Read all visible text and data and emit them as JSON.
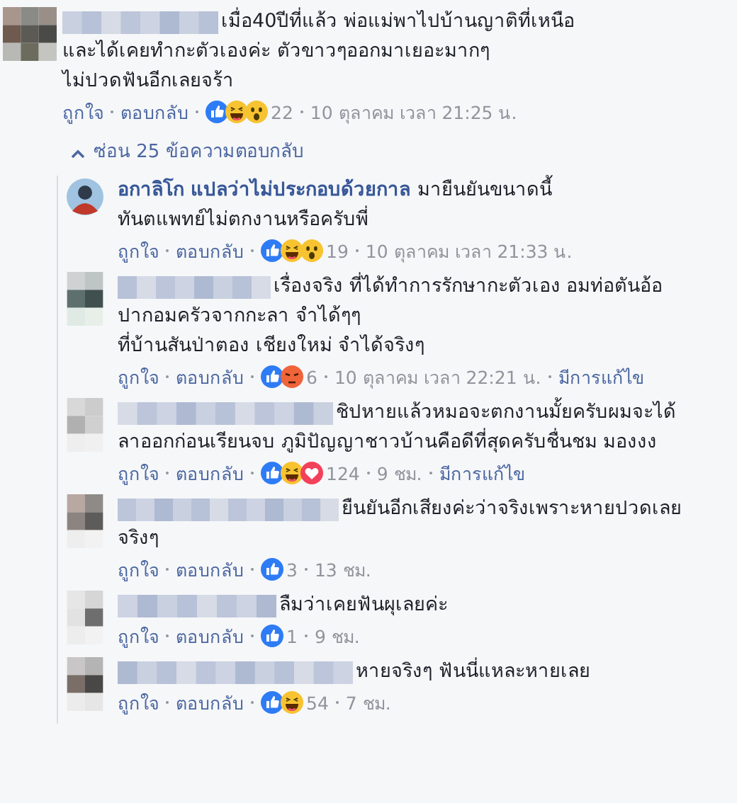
{
  "comment": {
    "lines": [
      "เมื่อ40ปีที่แล้ว พ่อแม่พาไปบ้านญาติที่เหนือ",
      "และได้เคยทำกะตัวเองค่ะ ตัวขาวๆออกมาเยอะมากๆ",
      "ไม่ปวดฟันอีกเลยจร้า"
    ],
    "like": "ถูกใจ",
    "reply": "ตอบกลับ",
    "reactions": [
      {
        "kind": "like"
      },
      {
        "kind": "haha"
      },
      {
        "kind": "wow"
      }
    ],
    "count": "22",
    "time": "10 ตุลาคม เวลา 21:25 น."
  },
  "replies_toggle": {
    "label": "ซ่อน 25 ข้อความตอบกลับ",
    "expanded": true
  },
  "replies": [
    {
      "author": "อกาลิโก แปลว่าไม่ประกอบด้วยกาล",
      "lines": [
        "มายืนยันขนาดนี้",
        "ทันตแพทย์ไม่ตกงานหรือครับพี่"
      ],
      "like": "ถูกใจ",
      "reply": "ตอบกลับ",
      "reactions": [
        {
          "kind": "like"
        },
        {
          "kind": "haha"
        },
        {
          "kind": "wow"
        }
      ],
      "count": "19",
      "time": "10 ตุลาคม เวลา 21:33 น."
    },
    {
      "lines": [
        "เรื่องจริง ที่ได้ทำการรักษากะตัวเอง อมท่อตันอ้อ",
        "ปากอมครัวจากกะลา จำได้ๆๆ",
        "ที่บ้านสันป่าตอง เชียงใหม่ จำได้จริงๆ"
      ],
      "like": "ถูกใจ",
      "reply": "ตอบกลับ",
      "reactions": [
        {
          "kind": "like"
        },
        {
          "kind": "angry"
        }
      ],
      "count": "6",
      "time": "10 ตุลาคม เวลา 22:21 น.",
      "edited": "มีการแก้ไข"
    },
    {
      "lines": [
        "ชิปหายแล้วหมอจะตกงานมั้ยครับผมจะได้",
        "ลาออกก่อนเรียนจบ ภูมิปัญญาชาวบ้านคือดีที่สุดครับชื่นชม มองงง"
      ],
      "like": "ถูกใจ",
      "reply": "ตอบกลับ",
      "reactions": [
        {
          "kind": "like"
        },
        {
          "kind": "haha"
        },
        {
          "kind": "love"
        }
      ],
      "count": "124",
      "time": "9 ชม.",
      "edited": "มีการแก้ไข"
    },
    {
      "lines": [
        "ยืนยันอีกเสียงค่ะว่าจริงเพราะหายปวดเลย",
        "จริงๆ"
      ],
      "like": "ถูกใจ",
      "reply": "ตอบกลับ",
      "reactions": [
        {
          "kind": "like"
        }
      ],
      "count": "3",
      "time": "13 ชม."
    },
    {
      "lines": [
        "ลืมว่าเคยฟันผุเลยค่ะ"
      ],
      "like": "ถูกใจ",
      "reply": "ตอบกลับ",
      "reactions": [
        {
          "kind": "like"
        }
      ],
      "count": "1",
      "time": "9 ชม."
    },
    {
      "lines": [
        "หายจริงๆ ฟันนี่แหละหายเลย"
      ],
      "like": "ถูกใจ",
      "reply": "ตอบกลับ",
      "reactions": [
        {
          "kind": "like"
        },
        {
          "kind": "haha"
        }
      ],
      "count": "54",
      "time": "7 ชม."
    }
  ]
}
